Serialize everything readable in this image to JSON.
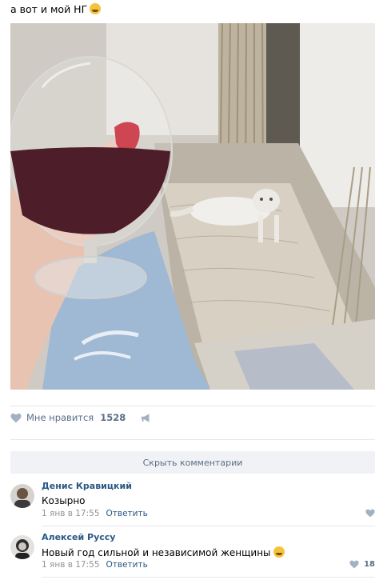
{
  "post": {
    "text": "а вот и мой НГ"
  },
  "actions": {
    "like_label": "Мне нравится",
    "like_count": "1528"
  },
  "comments": {
    "hide_label": "Скрыть комментарии",
    "items": [
      {
        "author": "Денис Кравицкий",
        "text": "Козырно",
        "date": "1 янв в 17:55",
        "reply_label": "Ответить",
        "likes": ""
      },
      {
        "author": "Алексей Руссу",
        "text": "Новый год сильной и независимой женщины",
        "date": "1 янв в 17:55",
        "reply_label": "Ответить",
        "likes": "18"
      }
    ]
  },
  "colors": {
    "link": "#2a5885",
    "muted": "#939393",
    "icon": "#a3b2c3",
    "bar": "#f0f2f5"
  }
}
